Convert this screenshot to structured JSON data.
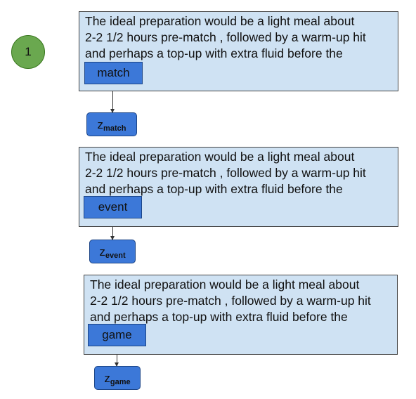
{
  "node_label": "1",
  "blocks": [
    {
      "lines": [
        "The ideal preparation would be a light meal about",
        "2-2 1/2 hours pre-match , followed by a warm-up hit",
        "and perhaps a top-up with extra fluid before the"
      ],
      "word": "match",
      "z_base": "z",
      "z_sub": "match"
    },
    {
      "lines": [
        "The ideal preparation would be a light meal about",
        "2-2 1/2 hours pre-match , followed by a warm-up hit",
        "and perhaps a top-up with extra fluid before the"
      ],
      "word": "event",
      "z_base": "z",
      "z_sub": "event"
    },
    {
      "lines": [
        "The ideal preparation would be a light meal about",
        "2-2 1/2 hours pre-match , followed by a warm-up hit",
        "and perhaps a top-up with extra fluid before the"
      ],
      "word": "game",
      "z_base": "z",
      "z_sub": "game"
    }
  ],
  "colors": {
    "circle_fill": "#6aa84f",
    "box_fill": "#cfe2f3",
    "word_fill": "#3c78d8"
  }
}
